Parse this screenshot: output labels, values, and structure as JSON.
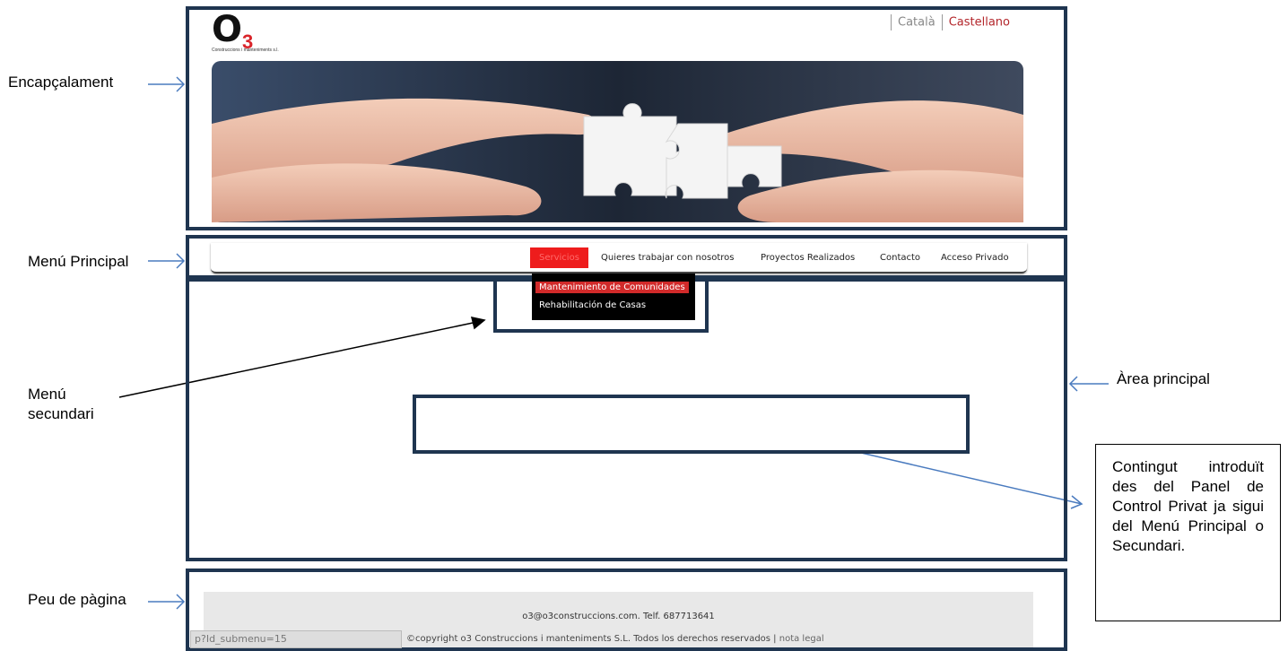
{
  "annotations": {
    "header": "Encapçalament",
    "main_menu": "Menú Principal",
    "secondary_menu_line1": "Menú",
    "secondary_menu_line2": "secundari",
    "main_area": "Àrea principal",
    "footer": "Peu de pàgina",
    "content_note": "Contingut introduït des del Panel de Control Privat ja sigui del Menú Principal o Secundari."
  },
  "site": {
    "logo_letter": "O",
    "logo_number": "3",
    "logo_tagline": "Construccions i manteniments s.l.",
    "languages": [
      "Català",
      "Castellano"
    ],
    "active_language": "Castellano",
    "banner_image": "hands-puzzle-pieces"
  },
  "menu": {
    "items": [
      "Servicios",
      "Quieres trabajar con nosotros",
      "Proyectos Realizados",
      "Contacto",
      "Acceso Privado"
    ],
    "active": "Servicios",
    "submenu": [
      "Mantenimiento de Comunidades",
      "Rehabilitación de Casas"
    ]
  },
  "footer": {
    "contact": "o3@o3construccions.com. Telf. 687713641",
    "url_fragment": "p?Id_submenu=15",
    "copyright": "©copyright o3 Construccions i manteniments S.L. Todos los derechos reservados |",
    "legal_link": "nota legal"
  },
  "colors": {
    "frame": "#1f3550",
    "accent_red": "#ee1c1c",
    "arrow_blue": "#4a7bbf"
  }
}
